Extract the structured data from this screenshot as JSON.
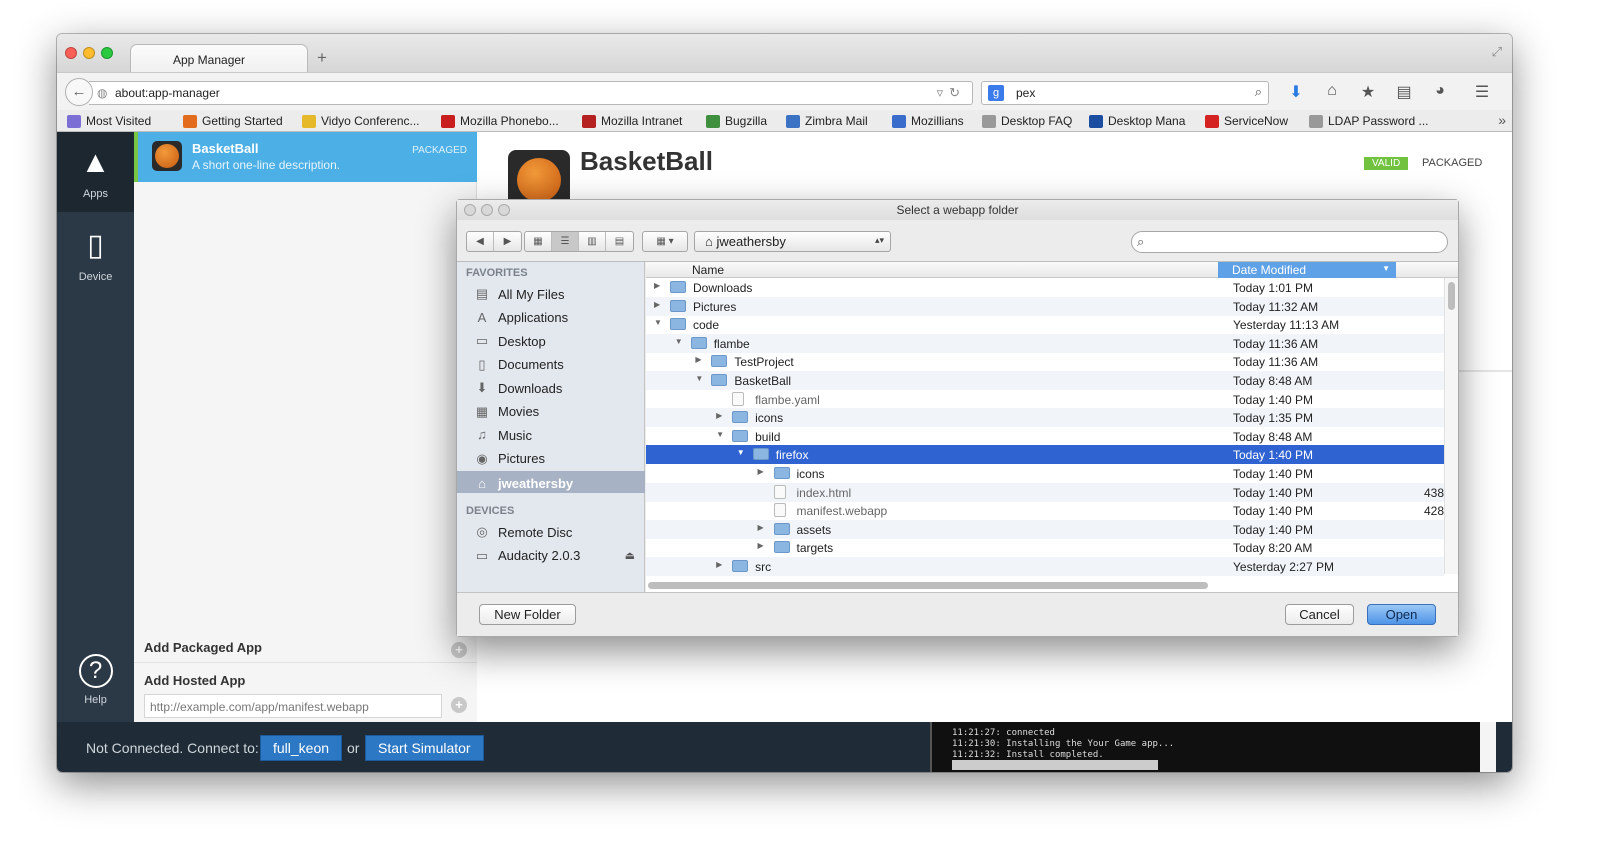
{
  "browser": {
    "tab_title": "App Manager",
    "new_tab": "+",
    "url": "about:app-manager",
    "search_query": "pex",
    "search_engine_badge": "g",
    "bookmarks": [
      {
        "label": "Most Visited",
        "icon": "folder-icon",
        "color": "#7b6fd6"
      },
      {
        "label": "Getting Started",
        "icon": "firefox-icon",
        "color": "#e26b1d"
      },
      {
        "label": "Vidyo Conferenc...",
        "icon": "vidyo-icon",
        "color": "#e6b92a"
      },
      {
        "label": "Mozilla Phonebo...",
        "icon": "dino-icon",
        "color": "#c81e1e"
      },
      {
        "label": "Mozilla Intranet",
        "icon": "dino-icon",
        "color": "#b52020"
      },
      {
        "label": "Bugzilla",
        "icon": "bug-icon",
        "color": "#3f8f3f"
      },
      {
        "label": "Zimbra Mail",
        "icon": "zimbra-icon",
        "color": "#3b72c4"
      },
      {
        "label": "Mozillians",
        "icon": "mozillians-icon",
        "color": "#3a6ccc"
      },
      {
        "label": "Desktop FAQ",
        "icon": "page-icon",
        "color": "#999999"
      },
      {
        "label": "Desktop Mana",
        "icon": "x-icon",
        "color": "#1b4ea1"
      },
      {
        "label": "ServiceNow",
        "icon": "servicenow-icon",
        "color": "#d42121"
      },
      {
        "label": "LDAP Password ...",
        "icon": "page-icon",
        "color": "#999999"
      }
    ]
  },
  "sidebar_nav": {
    "apps_label": "Apps",
    "device_label": "Device",
    "help_label": "Help"
  },
  "applist": {
    "app_name": "BasketBall",
    "app_desc": "A short one-line description.",
    "app_type": "PACKAGED",
    "add_packaged": "Add Packaged App",
    "add_hosted": "Add Hosted App",
    "hosted_placeholder": "http://example.com/app/manifest.webapp"
  },
  "detail": {
    "title": "BasketBall",
    "valid_badge": "VALID",
    "type": "PACKAGED"
  },
  "bottombar": {
    "status": "Not Connected. Connect to:",
    "device_button": "full_keon",
    "or": "or",
    "simulator_button": "Start Simulator",
    "log": [
      "11:21:27: connected",
      "11:21:30: Installing the Your Game app...",
      "11:21:32: Install completed."
    ]
  },
  "dialog": {
    "title": "Select a webapp folder",
    "path": "jweathersby",
    "favorites_header": "FAVORITES",
    "favorites": [
      {
        "label": "All My Files",
        "icon": "all-files-icon",
        "glyph": "▤"
      },
      {
        "label": "Applications",
        "icon": "applications-icon",
        "glyph": "A"
      },
      {
        "label": "Desktop",
        "icon": "desktop-icon",
        "glyph": "▭"
      },
      {
        "label": "Documents",
        "icon": "documents-icon",
        "glyph": "▯"
      },
      {
        "label": "Downloads",
        "icon": "downloads-icon",
        "glyph": "⬇"
      },
      {
        "label": "Movies",
        "icon": "movies-icon",
        "glyph": "▦"
      },
      {
        "label": "Music",
        "icon": "music-icon",
        "glyph": "♫"
      },
      {
        "label": "Pictures",
        "icon": "pictures-icon",
        "glyph": "◉"
      },
      {
        "label": "jweathersby",
        "icon": "home-icon",
        "glyph": "⌂"
      }
    ],
    "devices_header": "DEVICES",
    "devices": [
      {
        "label": "Remote Disc",
        "icon": "disc-icon",
        "glyph": "◎"
      },
      {
        "label": "Audacity 2.0.3",
        "icon": "drive-icon",
        "glyph": "▭"
      }
    ],
    "col_name": "Name",
    "col_date": "Date Modified",
    "rows": [
      {
        "name": "Downloads",
        "date": "Today 1:01 PM",
        "size": "",
        "depth": 0,
        "kind": "folder",
        "tw": "▶"
      },
      {
        "name": "Pictures",
        "date": "Today 11:32 AM",
        "size": "",
        "depth": 0,
        "kind": "folder",
        "tw": "▶"
      },
      {
        "name": "code",
        "date": "Yesterday 11:13 AM",
        "size": "",
        "depth": 0,
        "kind": "folder",
        "tw": "▼"
      },
      {
        "name": "flambe",
        "date": "Today 11:36 AM",
        "size": "",
        "depth": 1,
        "kind": "folder",
        "tw": "▼"
      },
      {
        "name": "TestProject",
        "date": "Today 11:36 AM",
        "size": "",
        "depth": 2,
        "kind": "folder",
        "tw": "▶"
      },
      {
        "name": "BasketBall",
        "date": "Today 8:48 AM",
        "size": "",
        "depth": 2,
        "kind": "folder",
        "tw": "▼"
      },
      {
        "name": "flambe.yaml",
        "date": "Today 1:40 PM",
        "size": "",
        "depth": 3,
        "kind": "file",
        "tw": ""
      },
      {
        "name": "icons",
        "date": "Today 1:35 PM",
        "size": "",
        "depth": 3,
        "kind": "folder",
        "tw": "▶"
      },
      {
        "name": "build",
        "date": "Today 8:48 AM",
        "size": "",
        "depth": 3,
        "kind": "folder",
        "tw": "▼"
      },
      {
        "name": "firefox",
        "date": "Today 1:40 PM",
        "size": "",
        "depth": 4,
        "kind": "folder",
        "tw": "▼",
        "selected": true
      },
      {
        "name": "icons",
        "date": "Today 1:40 PM",
        "size": "",
        "depth": 5,
        "kind": "folder",
        "tw": "▶"
      },
      {
        "name": "index.html",
        "date": "Today 1:40 PM",
        "size": "438",
        "depth": 5,
        "kind": "file",
        "tw": ""
      },
      {
        "name": "manifest.webapp",
        "date": "Today 1:40 PM",
        "size": "428",
        "depth": 5,
        "kind": "file",
        "tw": ""
      },
      {
        "name": "assets",
        "date": "Today 1:40 PM",
        "size": "",
        "depth": 5,
        "kind": "folder",
        "tw": "▶"
      },
      {
        "name": "targets",
        "date": "Today 8:20 AM",
        "size": "",
        "depth": 5,
        "kind": "folder",
        "tw": "▶"
      },
      {
        "name": "src",
        "date": "Yesterday 2:27 PM",
        "size": "",
        "depth": 3,
        "kind": "folder",
        "tw": "▶"
      }
    ],
    "new_folder": "New Folder",
    "cancel": "Cancel",
    "open": "Open"
  }
}
